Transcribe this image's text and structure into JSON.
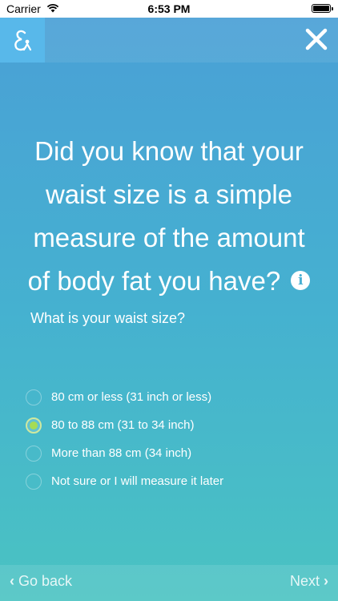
{
  "status_bar": {
    "carrier": "Carrier",
    "time": "6:53 PM"
  },
  "header": {
    "logo_icon": "ampersand-person-icon",
    "close_icon": "close-icon"
  },
  "question": {
    "text": "Did you know that your waist size is a simple measure of the amount of body fat you have?",
    "info_icon": "i"
  },
  "sub_question": "What is your waist size?",
  "options": [
    {
      "label": "80 cm or less (31 inch or less)",
      "selected": false
    },
    {
      "label": "80 to 88 cm (31 to 34 inch)",
      "selected": true
    },
    {
      "label": "More than 88 cm (34 inch)",
      "selected": false
    },
    {
      "label": "Not sure or I will measure it later",
      "selected": false
    }
  ],
  "footer": {
    "back_label": "Go back",
    "next_label": "Next",
    "back_chevron": "‹",
    "next_chevron": "›"
  },
  "colors": {
    "gradient_top": "#4aa0d6",
    "gradient_bottom": "#4ac3c2",
    "selected_radio": "#a5dc55"
  }
}
